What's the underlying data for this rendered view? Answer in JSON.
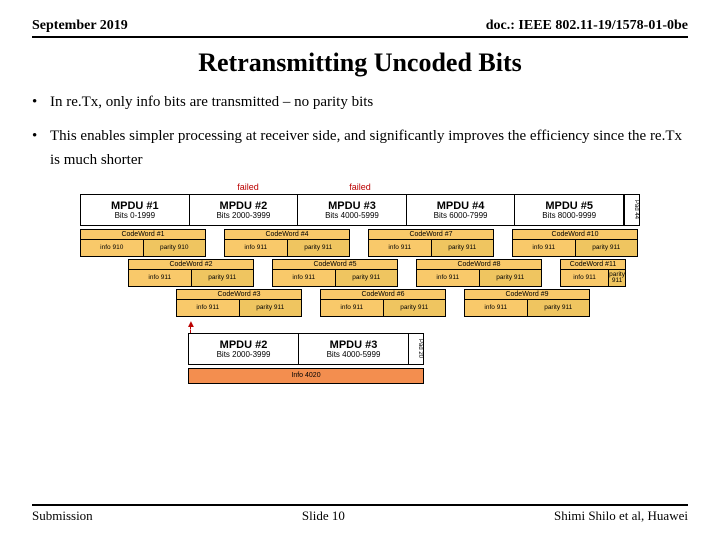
{
  "header": {
    "date": "September 2019",
    "doc": "doc.: IEEE 802.11-19/1578-01-0be"
  },
  "title": "Retransmitting Uncoded Bits",
  "bullets": [
    "In re.Tx, only info bits are transmitted – no parity bits",
    "This enables simpler processing at receiver side, and significantly improves the efficiency since the re.Tx is much shorter"
  ],
  "failed": "failed",
  "mpdus": [
    {
      "t": "MPDU #1",
      "b": "Bits 0-1999"
    },
    {
      "t": "MPDU #2",
      "b": "Bits 2000-3999"
    },
    {
      "t": "MPDU #3",
      "b": "Bits 4000-5999"
    },
    {
      "t": "MPDU #4",
      "b": "Bits 6000-7999"
    },
    {
      "t": "MPDU #5",
      "b": "Bits 8000-9999"
    }
  ],
  "pad_label": "Pad 44",
  "codewords": {
    "r1": [
      {
        "h": "CodeWord #1",
        "i": "info 910",
        "p": "parity 910"
      },
      {
        "h": "CodeWord #4",
        "i": "info 911",
        "p": "parity 911"
      },
      {
        "h": "CodeWord #7",
        "i": "info 911",
        "p": "parity 911"
      },
      {
        "h": "CodeWord #10",
        "i": "info 911",
        "p": "parity 911"
      }
    ],
    "r2": [
      {
        "h": "CodeWord #2",
        "i": "info 911",
        "p": "parity 911"
      },
      {
        "h": "CodeWord #5",
        "i": "info 911",
        "p": "parity 911"
      },
      {
        "h": "CodeWord #8",
        "i": "info 911",
        "p": "parity 911"
      },
      {
        "h": "CodeWord #11",
        "i": "info 911",
        "p": "parity 911"
      }
    ],
    "r3": [
      {
        "h": "CodeWord #3",
        "i": "info 911",
        "p": "parity 911"
      },
      {
        "h": "CodeWord #6",
        "i": "info 911",
        "p": "parity 911"
      },
      {
        "h": "CodeWord #9",
        "i": "info 911",
        "p": "parity 911"
      }
    ]
  },
  "retx": {
    "mpdus": [
      {
        "t": "MPDU #2",
        "b": "Bits 2000-3999"
      },
      {
        "t": "MPDU #3",
        "b": "Bits 4000-5999"
      }
    ],
    "pad": "Pad 20",
    "info": "Info 4020"
  },
  "footer": {
    "left": "Submission",
    "center": "Slide 10",
    "right": "Shimi Shilo et al, Huawei"
  }
}
